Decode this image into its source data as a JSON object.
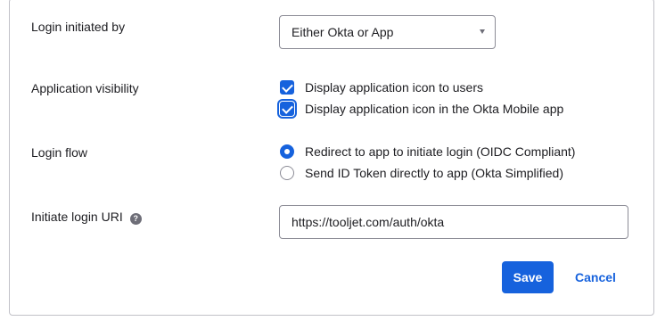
{
  "form": {
    "login_initiated_by": {
      "label": "Login initiated by",
      "selected": "Either Okta or App"
    },
    "application_visibility": {
      "label": "Application visibility",
      "options": [
        {
          "label": "Display application icon to users",
          "checked": true
        },
        {
          "label": "Display application icon in the Okta Mobile app",
          "checked": true
        }
      ]
    },
    "login_flow": {
      "label": "Login flow",
      "options": [
        {
          "label": "Redirect to app to initiate login (OIDC Compliant)",
          "selected": true
        },
        {
          "label": "Send ID Token directly to app (Okta Simplified)",
          "selected": false
        }
      ]
    },
    "initiate_login_uri": {
      "label": "Initiate login URI",
      "help_icon": "?",
      "value": "https://tooljet.com/auth/okta"
    }
  },
  "actions": {
    "save_label": "Save",
    "cancel_label": "Cancel"
  },
  "colors": {
    "accent": "#1662dd",
    "border": "#8c8c96",
    "text": "#1d1d21"
  },
  "icons": {
    "dropdown": "chevron-down-icon",
    "help": "question-circle-icon",
    "checkbox": "checkmark-icon",
    "radio": "radio-dot-icon"
  }
}
